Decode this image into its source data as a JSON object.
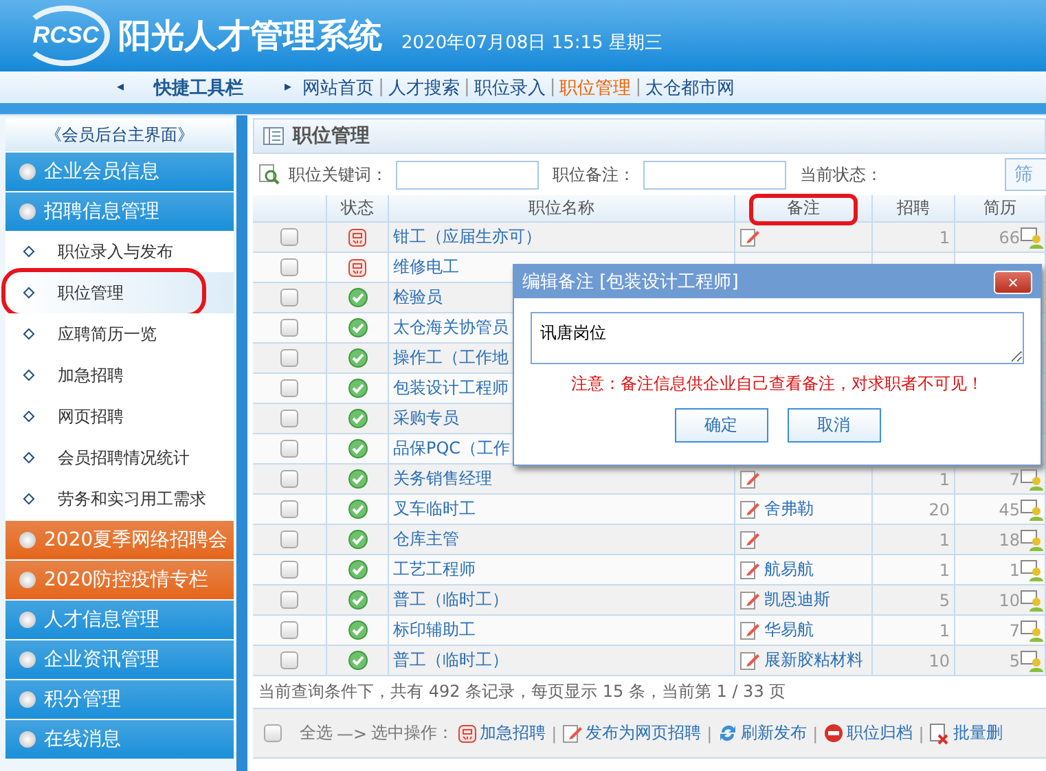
{
  "header": {
    "logo": "RCSC",
    "title": "阳光人才管理系统",
    "datetime": "2020年07月08日 15:15 星期三"
  },
  "quickbar": {
    "label": "快捷工具栏",
    "separator": "|",
    "prev": "◂",
    "next": "▸",
    "links": [
      {
        "label": "网站首页",
        "selected": false
      },
      {
        "label": "人才搜索",
        "selected": false
      },
      {
        "label": "职位录入",
        "selected": false
      },
      {
        "label": "职位管理",
        "selected": true
      },
      {
        "label": "太仓都市网",
        "selected": false
      }
    ]
  },
  "sidebar": {
    "home": "《会员后台主界面》",
    "sections": [
      {
        "label": "企业会员信息",
        "color": "#1a8fd9"
      },
      {
        "label": "招聘信息管理",
        "color": "#1a8fd9",
        "children": [
          {
            "label": "职位录入与发布",
            "selected": false
          },
          {
            "label": "职位管理",
            "selected": true
          },
          {
            "label": "应聘简历一览",
            "selected": false
          },
          {
            "label": "加急招聘",
            "selected": false
          },
          {
            "label": "网页招聘",
            "selected": false
          },
          {
            "label": "会员招聘情况统计",
            "selected": false
          },
          {
            "label": "劳务和实习用工需求",
            "selected": false
          }
        ]
      },
      {
        "label": "2020夏季网络招聘会",
        "color": "#e5661b"
      },
      {
        "label": "2020防控疫情专栏",
        "color": "#e5661b"
      },
      {
        "label": "人才信息管理",
        "color": "#1a8fd9"
      },
      {
        "label": "企业资讯管理",
        "color": "#1a8fd9"
      },
      {
        "label": "积分管理",
        "color": "#1a8fd9"
      },
      {
        "label": "在线消息",
        "color": "#1a8fd9"
      }
    ]
  },
  "panel": {
    "title": "职位管理",
    "search": {
      "keyword_label": "职位关键词：",
      "remark_label": "职位备注：",
      "status_label": "当前状态：",
      "filter_button": "筛"
    },
    "columns": [
      "状态",
      "职位名称",
      "备注",
      "招聘",
      "简历"
    ],
    "rows": [
      {
        "checked": false,
        "urgent": true,
        "name": "钳工（应届生亦可）",
        "remark": "",
        "recruits": "1",
        "resumes": "66"
      },
      {
        "checked": false,
        "urgent": true,
        "name": "维修电工"
      },
      {
        "checked": false,
        "urgent": false,
        "name": "检验员"
      },
      {
        "checked": false,
        "urgent": false,
        "name": "太仓海关协管员"
      },
      {
        "checked": false,
        "urgent": false,
        "name": "操作工（工作地"
      },
      {
        "checked": false,
        "urgent": false,
        "name": "包装设计工程师"
      },
      {
        "checked": false,
        "urgent": false,
        "name": "采购专员"
      },
      {
        "checked": false,
        "urgent": false,
        "name": "品保PQC（工作"
      },
      {
        "checked": false,
        "urgent": false,
        "name": "关务销售经理",
        "remark": "",
        "recruits": "1",
        "resumes": "7"
      },
      {
        "checked": false,
        "urgent": false,
        "name": "叉车临时工",
        "remark": "舍弗勒",
        "recruits": "20",
        "resumes": "45"
      },
      {
        "checked": false,
        "urgent": false,
        "name": "仓库主管",
        "remark": "",
        "recruits": "1",
        "resumes": "18"
      },
      {
        "checked": false,
        "urgent": false,
        "name": "工艺工程师",
        "remark": "航易航",
        "recruits": "1",
        "resumes": "1"
      },
      {
        "checked": false,
        "urgent": false,
        "name": "普工（临时工）",
        "remark": "凯恩迪斯",
        "recruits": "5",
        "resumes": "10"
      },
      {
        "checked": false,
        "urgent": false,
        "name": "标印辅助工",
        "remark": "华易航",
        "recruits": "1",
        "resumes": "7"
      },
      {
        "checked": false,
        "urgent": false,
        "name": "普工（临时工）",
        "remark": "展新胶粘材料",
        "recruits": "10",
        "resumes": "5"
      }
    ],
    "summary": "当前查询条件下，共有 492 条记录，每页显示 15 条，当前第 1 / 33 页",
    "actions": {
      "separator": "|",
      "select_all": "全选",
      "select_all_checked": false,
      "arrow": "—>",
      "label": "选中操作：",
      "items": [
        {
          "kind": "urgent",
          "label": "加急招聘"
        },
        {
          "kind": "publish",
          "label": "发布为网页招聘"
        },
        {
          "kind": "refresh",
          "label": "刷新发布"
        },
        {
          "kind": "archive",
          "label": "职位归档"
        },
        {
          "kind": "delete",
          "label": "批量删"
        }
      ]
    }
  },
  "dialog": {
    "title": "编辑备注 [包装设计工程师]",
    "close": "×",
    "value": "讯唐岗位",
    "notice": "注意：备注信息供企业自己查看备注，对求职者不可见！",
    "buttons": [
      "确定",
      "取消"
    ]
  }
}
